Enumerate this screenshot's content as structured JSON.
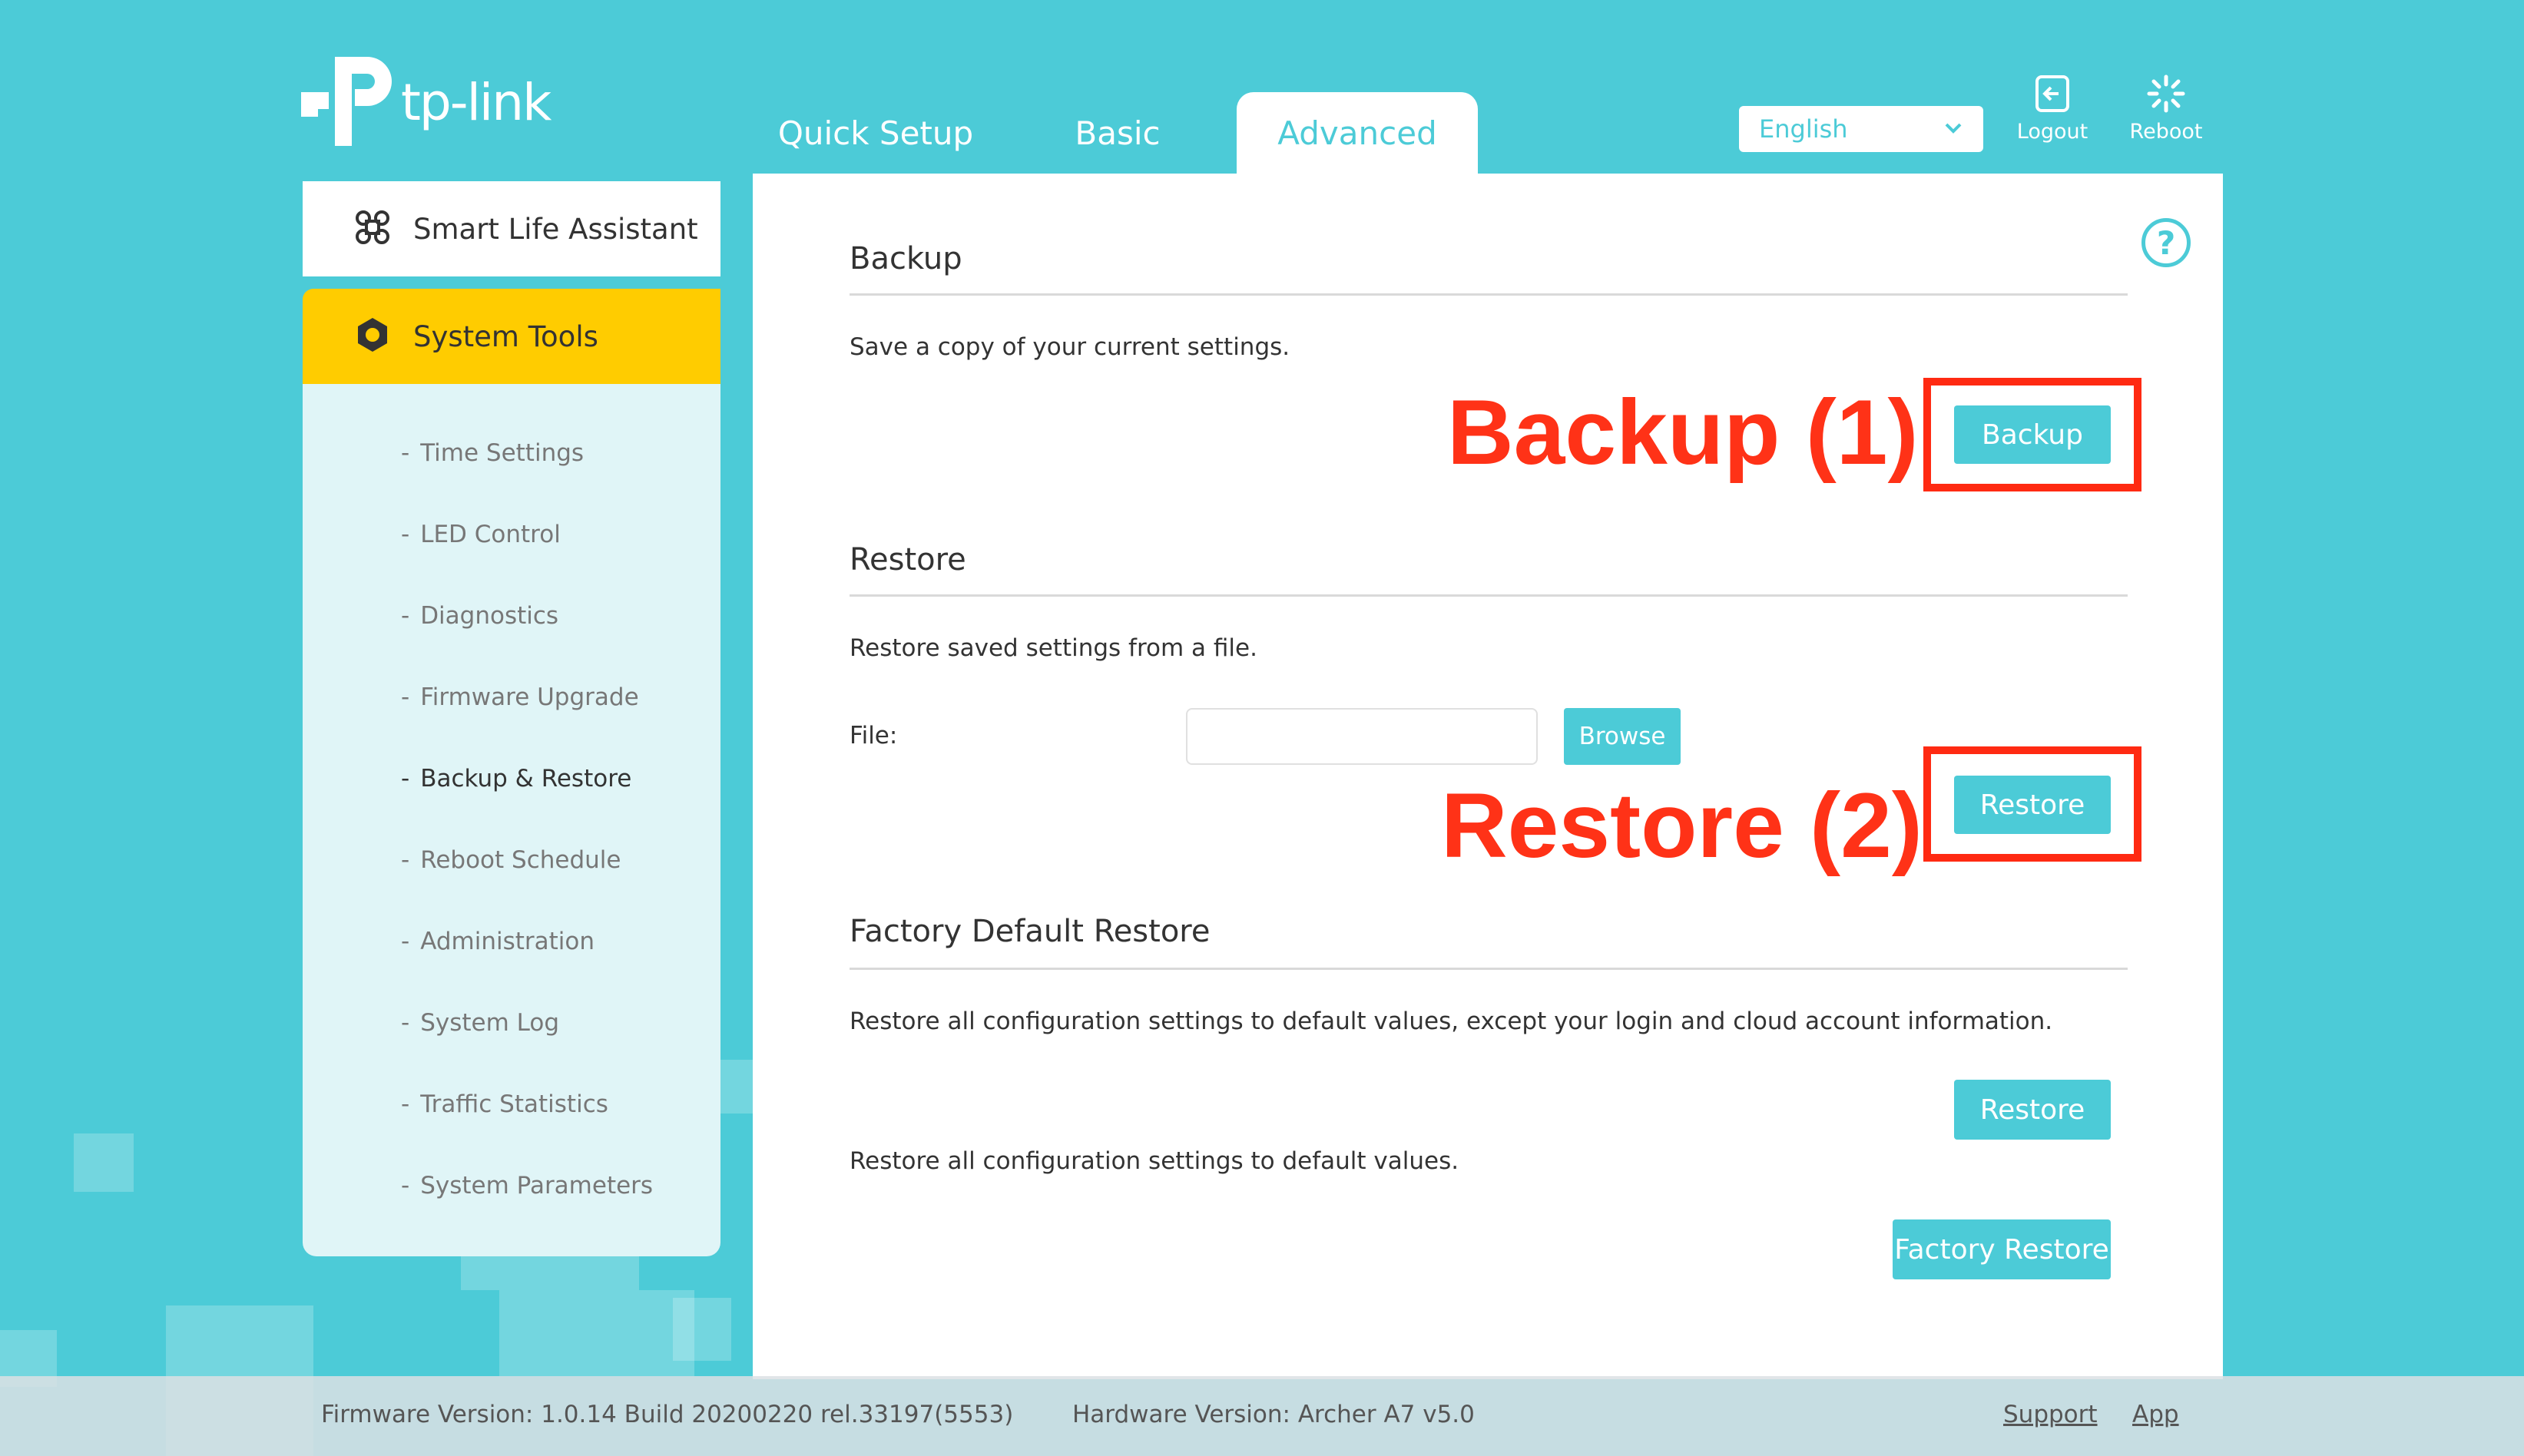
{
  "brand": {
    "name": "tp-link"
  },
  "tabs": [
    {
      "label": "Quick Setup"
    },
    {
      "label": "Basic"
    },
    {
      "label": "Advanced"
    }
  ],
  "header": {
    "language": "English",
    "logout_label": "Logout",
    "reboot_label": "Reboot"
  },
  "sidebar": {
    "smart_life": "Smart Life Assistant",
    "system_tools": "System Tools",
    "items": [
      {
        "label": "Time Settings"
      },
      {
        "label": "LED Control"
      },
      {
        "label": "Diagnostics"
      },
      {
        "label": "Firmware Upgrade"
      },
      {
        "label": "Backup & Restore"
      },
      {
        "label": "Reboot Schedule"
      },
      {
        "label": "Administration"
      },
      {
        "label": "System Log"
      },
      {
        "label": "Traffic Statistics"
      },
      {
        "label": "System Parameters"
      }
    ]
  },
  "main": {
    "backup": {
      "title": "Backup",
      "description": "Save a copy of your current settings.",
      "button": "Backup",
      "callout": "Backup (1)"
    },
    "restore": {
      "title": "Restore",
      "description": "Restore saved settings from a file.",
      "file_label": "File:",
      "file_value": "",
      "browse": "Browse",
      "button": "Restore",
      "callout": "Restore (2)"
    },
    "factory": {
      "title": "Factory Default Restore",
      "description1": "Restore all configuration settings to default values, except your login and cloud account information.",
      "button1": "Restore",
      "description2": "Restore all configuration settings to default values.",
      "button2": "Factory Restore"
    }
  },
  "footer": {
    "firmware": "Firmware Version: 1.0.14 Build 20200220 rel.33197(5553)",
    "hardware": "Hardware Version: Archer A7 v5.0",
    "support": "Support",
    "app": "App"
  },
  "colors": {
    "accent": "#4ccbd7",
    "active_nav": "#ffcc00",
    "callout": "#ff2a12"
  }
}
